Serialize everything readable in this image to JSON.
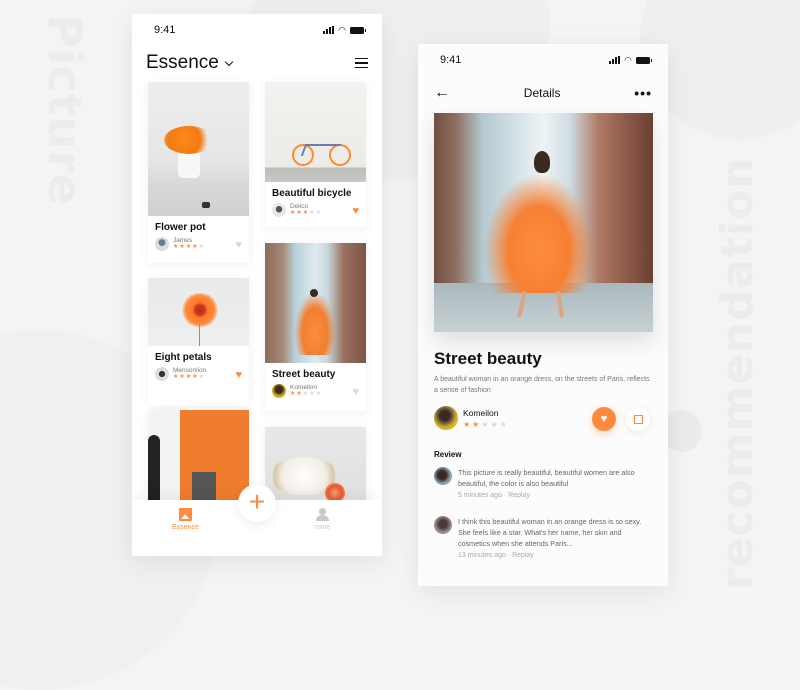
{
  "watermarks": {
    "left": "Picture",
    "right": "recommendation"
  },
  "colors": {
    "accent": "#ff8a3d",
    "star_off": "#d8d8d8",
    "text": "#111111"
  },
  "feed_screen": {
    "status_time": "9:41",
    "title": "Essence",
    "cards": [
      {
        "title": "Flower pot",
        "user": "James",
        "rating": 4,
        "max_rating": 5,
        "liked": false
      },
      {
        "title": "Beautiful bicycle",
        "user": "Delico",
        "rating": 3,
        "max_rating": 5,
        "liked": true
      },
      {
        "title": "Eight petals",
        "user": "Mensonlion",
        "rating": 4,
        "max_rating": 5,
        "liked": true
      },
      {
        "title": "Street beauty",
        "user": "Komeilon",
        "rating": 2,
        "max_rating": 5,
        "liked": false
      }
    ],
    "tabbar": {
      "essence_label": "Essence",
      "add_label": "+",
      "mine_label": "mine"
    }
  },
  "details_screen": {
    "status_time": "9:41",
    "header_title": "Details",
    "back_icon": "←",
    "more_icon": "•••",
    "title": "Street beauty",
    "description": "A beautiful woman in an orange dress, on the streets of Paris, reflects a sense of fashion",
    "author": {
      "name": "Komeilon",
      "rating": 2,
      "max_rating": 5
    },
    "like_icon": "♥",
    "review_heading": "Review",
    "reviews": [
      {
        "text": "This picture is really beautiful, beautiful women are also beautiful, the color is also beautiful",
        "time": "5 minutes ago",
        "action": "Replay"
      },
      {
        "text": "I think this beautiful woman in an orange dress is so sexy. She feels like a star. What's her name, her skin and cosmetics when she attends Paris...",
        "time": "13 minutes ago",
        "action": "Replay"
      }
    ]
  }
}
